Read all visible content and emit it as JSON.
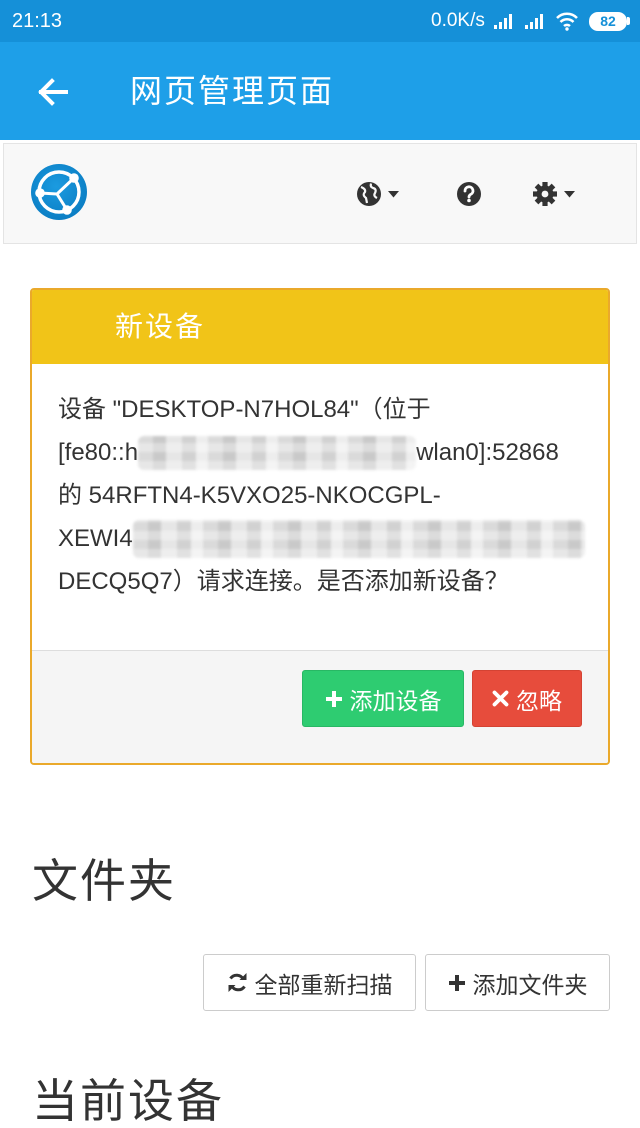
{
  "status_bar": {
    "time": "21:13",
    "net_speed": "0.0K/s",
    "battery_level": "82"
  },
  "app_bar": {
    "title": "网页管理页面"
  },
  "new_device_panel": {
    "title": "新设备",
    "message": {
      "line1": "设备 \"DESKTOP-N7HOL84\"（位于",
      "line2_start": "[fe80::h",
      "line2_end": "wlan0]:52868",
      "line3": "的 54RFTN4-K5VXO25-NKOCGPL-",
      "line4_start": "XEWI4",
      "line5": "DECQ5Q7）请求连接。是否添加新设备？"
    },
    "add_button_label": "添加设备",
    "ignore_button_label": "忽略"
  },
  "folders_section": {
    "heading": "文件夹",
    "rescan_all_label": "全部重新扫描",
    "add_folder_label": "添加文件夹"
  },
  "this_device_section": {
    "heading": "当前设备"
  },
  "icons": {
    "back": "arrow-left-icon",
    "logo": "syncthing-logo-icon",
    "language": "globe-icon",
    "help": "question-circle-icon",
    "settings": "gear-icon",
    "add": "plus-icon",
    "ignore": "times-icon",
    "rescan": "refresh-icon"
  },
  "colors": {
    "status_bar": "#1590d8",
    "app_bar": "#1e9fe8",
    "panel_header": "#f1c418",
    "add_button": "#2ecc71",
    "ignore_button": "#e74c3c"
  }
}
